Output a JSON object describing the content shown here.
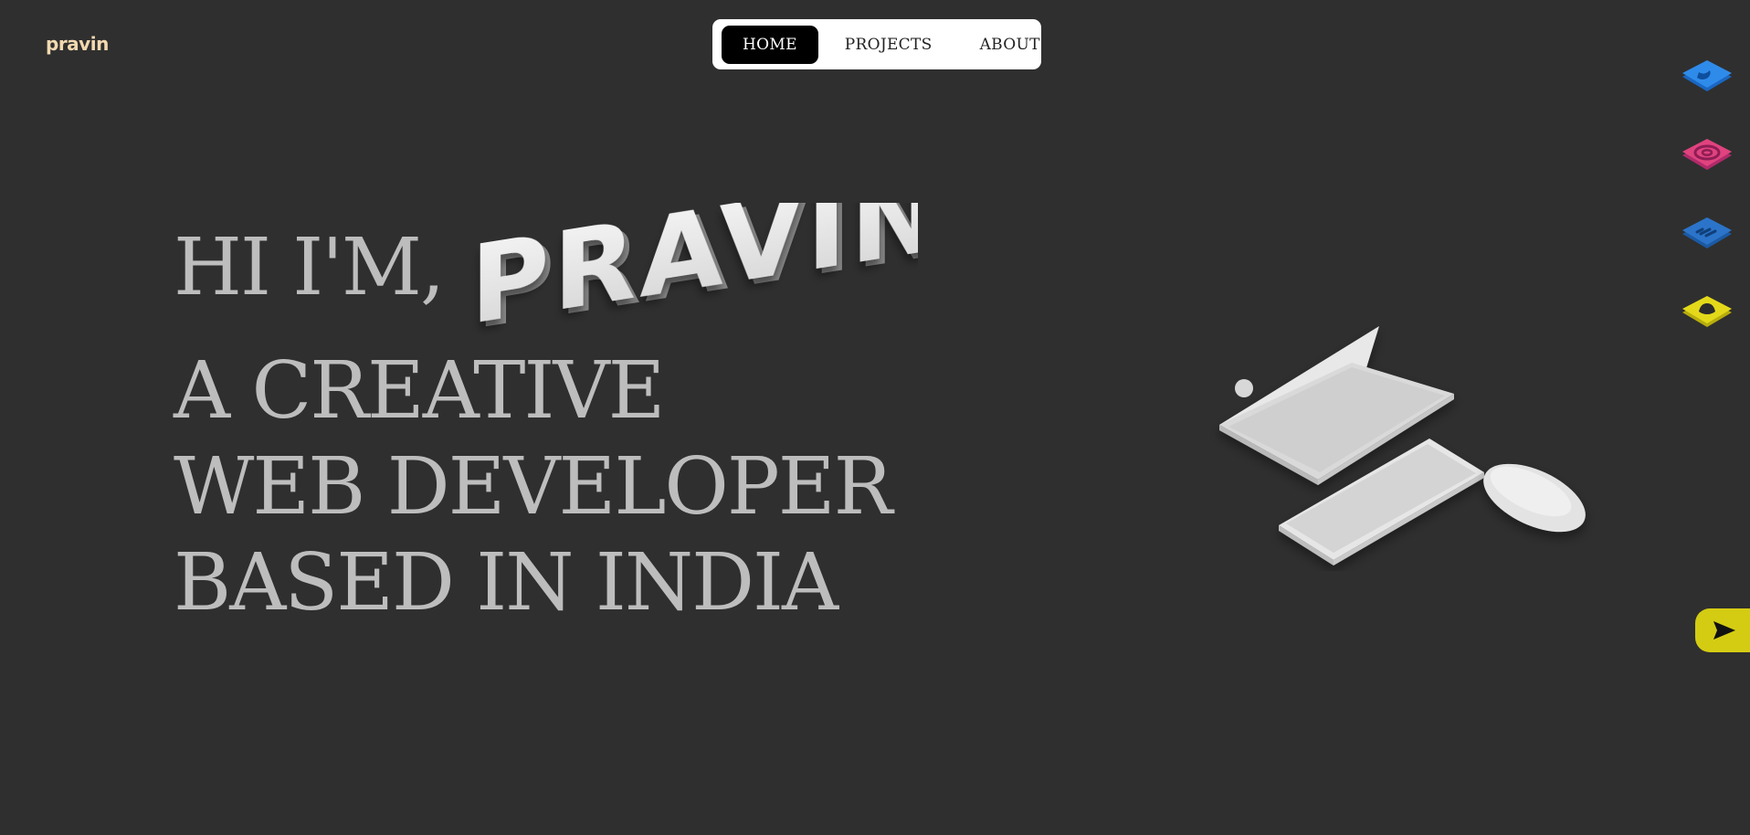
{
  "brand": {
    "logo_text": "pravin",
    "logo_color": "#f2d9b0"
  },
  "nav": {
    "items": [
      {
        "label": "HOME",
        "active": true
      },
      {
        "label": "PROJECTS",
        "active": false
      },
      {
        "label": "ABOUT",
        "active": false
      }
    ]
  },
  "hero": {
    "greeting": "HI I'M,",
    "name": "PRAVIN",
    "line2": "A CREATIVE",
    "line3": "WEB DEVELOPER",
    "line4": "BASED IN INDIA",
    "text_color": "#bdbdbd"
  },
  "illustration": {
    "items": [
      "laptop",
      "keyboard",
      "mouse"
    ]
  },
  "social": [
    {
      "icon": "twitter-icon",
      "color": "#2f8bea"
    },
    {
      "icon": "instagram-icon",
      "color": "#e0437e"
    },
    {
      "icon": "linkedin-icon",
      "color": "#2b74c9"
    },
    {
      "icon": "snapchat-icon",
      "color": "#e3d91a"
    }
  ],
  "send_button": {
    "icon": "send-icon",
    "color": "#d4cc13"
  },
  "colors": {
    "background": "#2f2f2f",
    "nav_bg": "#ffffff",
    "active_tab": "#000000"
  }
}
